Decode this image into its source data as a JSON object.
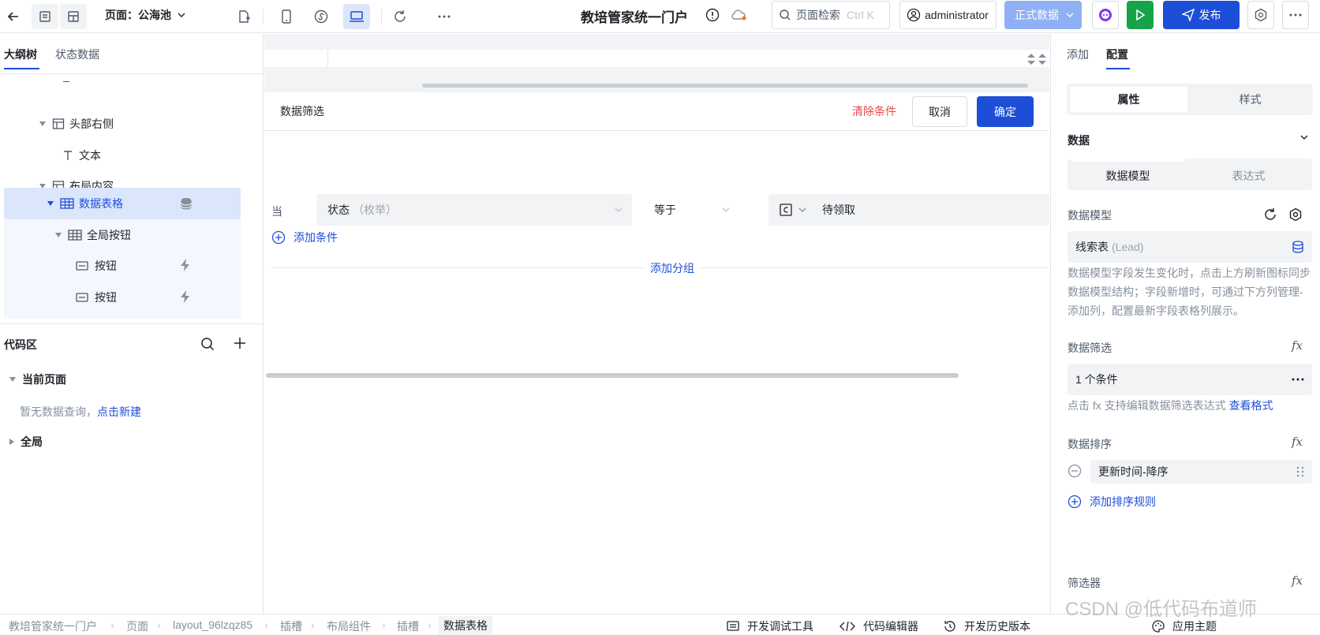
{
  "header": {
    "page_label": "页面：公海池",
    "app_title": "教培管家统一门户",
    "search_placeholder": "页面检索",
    "search_shortcut": "Ctrl K",
    "user": "administrator",
    "env": "正式数据",
    "publish": "发布"
  },
  "left": {
    "tabs": [
      "大纲树",
      "状态数据"
    ],
    "tree": [
      "头部右侧",
      "文本",
      "布局内容",
      "数据表格",
      "全局按钮",
      "按钮",
      "按钮"
    ],
    "code_title": "代码区",
    "current_page": "当前页面",
    "empty_text": "暂无数据查询，",
    "create_link": "点击新建",
    "global": "全局"
  },
  "filter": {
    "title": "数据筛选",
    "clear": "清除条件",
    "cancel": "取消",
    "confirm": "确定",
    "when": "当",
    "field": "状态",
    "field_type": "（枚举）",
    "operator": "等于",
    "value": "待领取",
    "add_condition": "添加条件",
    "add_group": "添加分组"
  },
  "right": {
    "tabs": [
      "添加",
      "配置"
    ],
    "seg": [
      "属性",
      "样式"
    ],
    "section": "数据",
    "subseg": [
      "数据模型",
      "表达式"
    ],
    "model_label": "数据模型",
    "model_name": "线索表",
    "model_code": "(Lead)",
    "model_hint": "数据模型字段发生变化时，点击上方刷新图标同步数据模型结构；字段新增时，可通过下方列管理-添加列，配置最新字段表格列展示。",
    "filter_label": "数据筛选",
    "filter_value": "1 个条件",
    "filter_hint": "点击 fx 支持编辑数据筛选表达式",
    "filter_link": "查看格式",
    "sort_label": "数据排序",
    "sort_value": "更新时间-降序",
    "add_sort": "添加排序规则",
    "filterer": "筛选器",
    "fx": "fx"
  },
  "bottom": {
    "crumbs": [
      "教培管家统一门户",
      "页面",
      "layout_96lzqz85",
      "插槽",
      "布局组件",
      "插槽",
      "数据表格"
    ],
    "tools": [
      "开发调试工具",
      "代码编辑器",
      "开发历史版本",
      "应用主题"
    ]
  },
  "watermark": "CSDN @低代码布道师",
  "colors": {
    "primary": "#1d4ed8",
    "danger": "#e5484d",
    "green": "#16a34a",
    "env_bg": "#8fb0f5"
  }
}
